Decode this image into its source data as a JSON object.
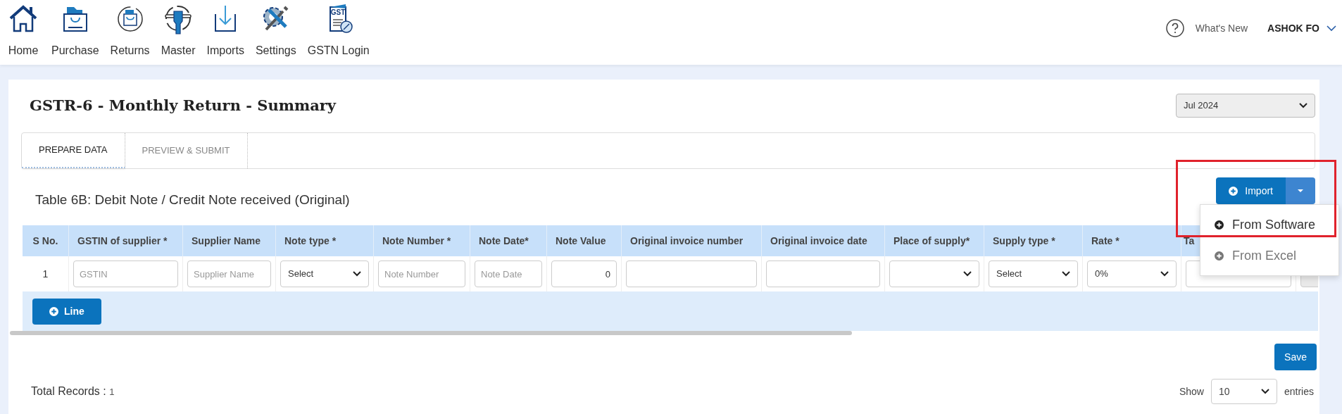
{
  "nav": {
    "items": [
      {
        "label": "Home",
        "kind": "home"
      },
      {
        "label": "Purchase",
        "kind": "bag"
      },
      {
        "label": "Returns",
        "kind": "returns"
      },
      {
        "label": "Master",
        "kind": "master"
      },
      {
        "label": "Imports",
        "kind": "imports"
      },
      {
        "label": "Settings",
        "kind": "settings"
      },
      {
        "label": "GSTN Login",
        "kind": "gst",
        "icon_text": "GST"
      }
    ],
    "whats_new": "What's New",
    "user": "ASHOK FO"
  },
  "page": {
    "title": "GSTR-6 - Monthly Return - Summary",
    "period": "Jul 2024",
    "tabs": [
      {
        "label": "PREPARE DATA",
        "selected": true
      },
      {
        "label": "PREVIEW & SUBMIT",
        "selected": false
      }
    ]
  },
  "section": {
    "title": "Table 6B: Debit Note / Credit Note received (Original)"
  },
  "import": {
    "label": "Import",
    "highlighted": true,
    "menu": [
      {
        "label": "From Software",
        "selected": true
      },
      {
        "label": "From Excel",
        "selected": false
      }
    ]
  },
  "table": {
    "columns": [
      "S No.",
      "GSTIN of supplier *",
      "Supplier Name",
      "Note type *",
      "Note Number *",
      "Note Date*",
      "Note Value",
      "Original invoice number",
      "Original invoice date",
      "Place of supply*",
      "Supply type *",
      "Rate *",
      "Ta",
      ""
    ],
    "rows": [
      {
        "cells": [
          {
            "kind": "text",
            "text": "1"
          },
          {
            "kind": "input",
            "placeholder": "GSTIN"
          },
          {
            "kind": "input",
            "placeholder": "Supplier Name"
          },
          {
            "kind": "select",
            "value": "Select"
          },
          {
            "kind": "input",
            "placeholder": "Note Number"
          },
          {
            "kind": "input",
            "placeholder": "Note Date"
          },
          {
            "kind": "number",
            "value": "0"
          },
          {
            "kind": "input"
          },
          {
            "kind": "input"
          },
          {
            "kind": "select"
          },
          {
            "kind": "select",
            "value": "Select"
          },
          {
            "kind": "select",
            "value": "0%"
          },
          {
            "kind": "input"
          },
          {
            "kind": "disabled"
          }
        ]
      }
    ],
    "add_line": "Line"
  },
  "save": "Save",
  "footer": {
    "total_label": "Total Records :",
    "total": "1",
    "show": "Show",
    "page_size": "10",
    "entries": "entries"
  }
}
